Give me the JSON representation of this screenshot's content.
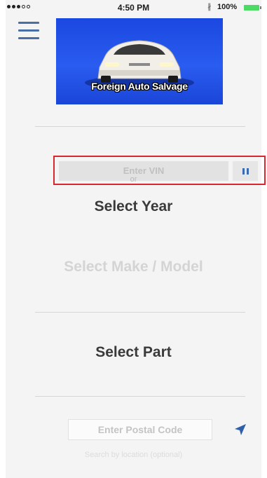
{
  "status_bar": {
    "time": "4:50 PM",
    "battery_percent": "100%",
    "bluetooth_symbol": "∦",
    "signal_icon": "signal-dots-icon",
    "battery_icon": "battery-icon",
    "battery_color": "#4cd964"
  },
  "header": {
    "menu_icon": "hamburger-menu-icon",
    "menu_color": "#4a6fa5",
    "logo_text": "Foreign Auto Salvage",
    "logo_background": "#1a48e0"
  },
  "vin": {
    "placeholder": "Enter VIN",
    "scan_icon": "barcode-scan-icon",
    "highlight_color": "#d9272e"
  },
  "separator": {
    "or_label": "or"
  },
  "selectors": {
    "year_label": "Select Year",
    "make_model_label": "Select Make / Model",
    "part_label": "Select Part"
  },
  "location": {
    "postal_placeholder": "Enter Postal Code",
    "locate_icon": "location-arrow-icon",
    "hint": "Search by location (optional)"
  }
}
